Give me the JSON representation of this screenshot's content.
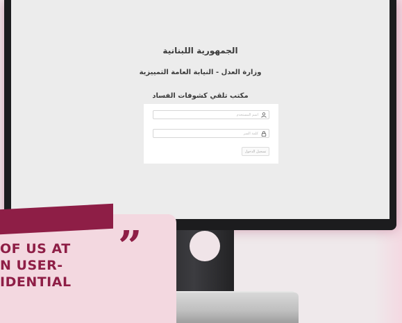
{
  "login_page": {
    "republic_title": "الجمهورية اللبنانية",
    "ministry_title": "وزارة العدل - النيابة العامة التمييزية",
    "office_title": "مكتب تلقي كشوفات الفساد",
    "username_placeholder": "اسم المستخدم",
    "password_placeholder": "كلمة السر",
    "login_button": "تسجيل الدخول",
    "username_icon": "user-icon",
    "password_icon": "lock-icon"
  },
  "quote": {
    "text": "OF US AT\nN USER-\nIDENTIAL",
    "mark": "”",
    "accent_color": "#8e1e46",
    "banner_color": "#f3d8e0"
  }
}
